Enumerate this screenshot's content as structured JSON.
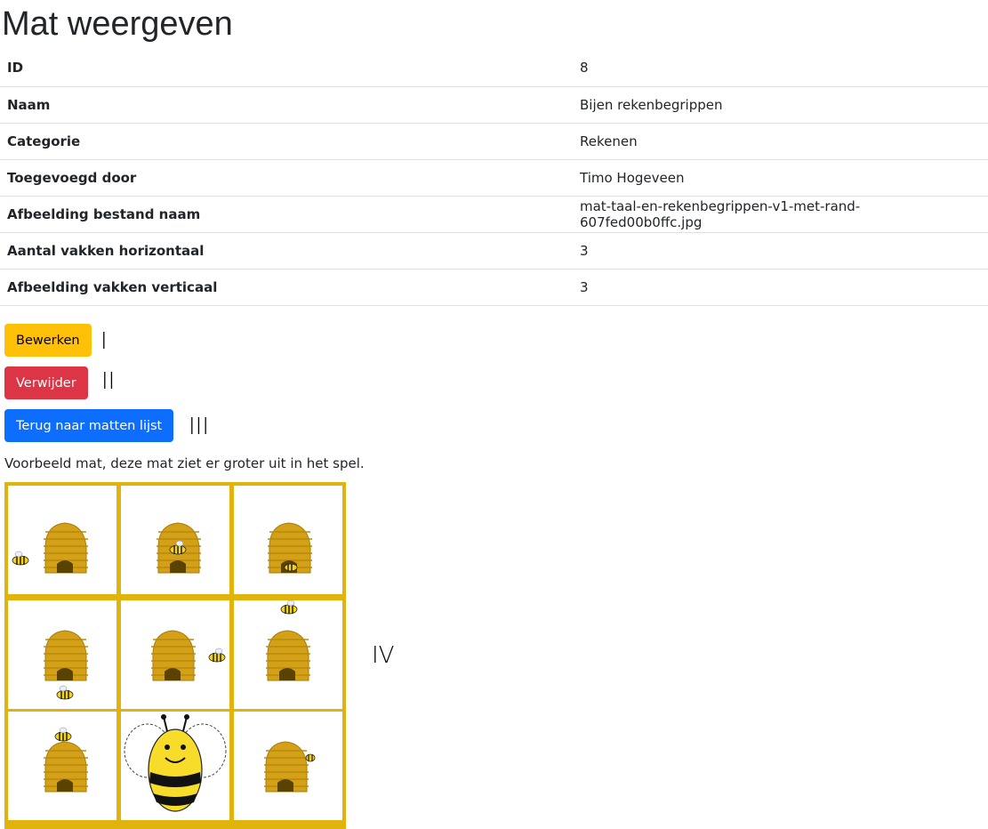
{
  "page_title": "Mat weergeven",
  "details": [
    {
      "key": "ID",
      "value": "8"
    },
    {
      "key": "Naam",
      "value": "Bijen rekenbegrippen"
    },
    {
      "key": "Categorie",
      "value": "Rekenen"
    },
    {
      "key": "Toegevoegd door",
      "value": "Timo Hogeveen"
    },
    {
      "key": "Afbeelding bestand naam",
      "value": "mat-taal-en-rekenbegrippen-v1-met-rand-607fed00b0ffc.jpg"
    },
    {
      "key": "Aantal vakken horizontaal",
      "value": "3"
    },
    {
      "key": "Afbeelding vakken verticaal",
      "value": "3"
    }
  ],
  "buttons": {
    "edit": "Bewerken",
    "delete": "Verwijder",
    "back": "Terug naar matten lijst"
  },
  "markers": {
    "one": "I",
    "two": "II",
    "three": "III",
    "four": "IV"
  },
  "caption": "Voorbeeld mat, deze mat ziet er groter uit in het spel.",
  "colors": {
    "warning": "#ffc107",
    "danger": "#dc3545",
    "primary": "#0d6efd",
    "mat_border": "#e0b40d",
    "hive": "#d4a017"
  }
}
